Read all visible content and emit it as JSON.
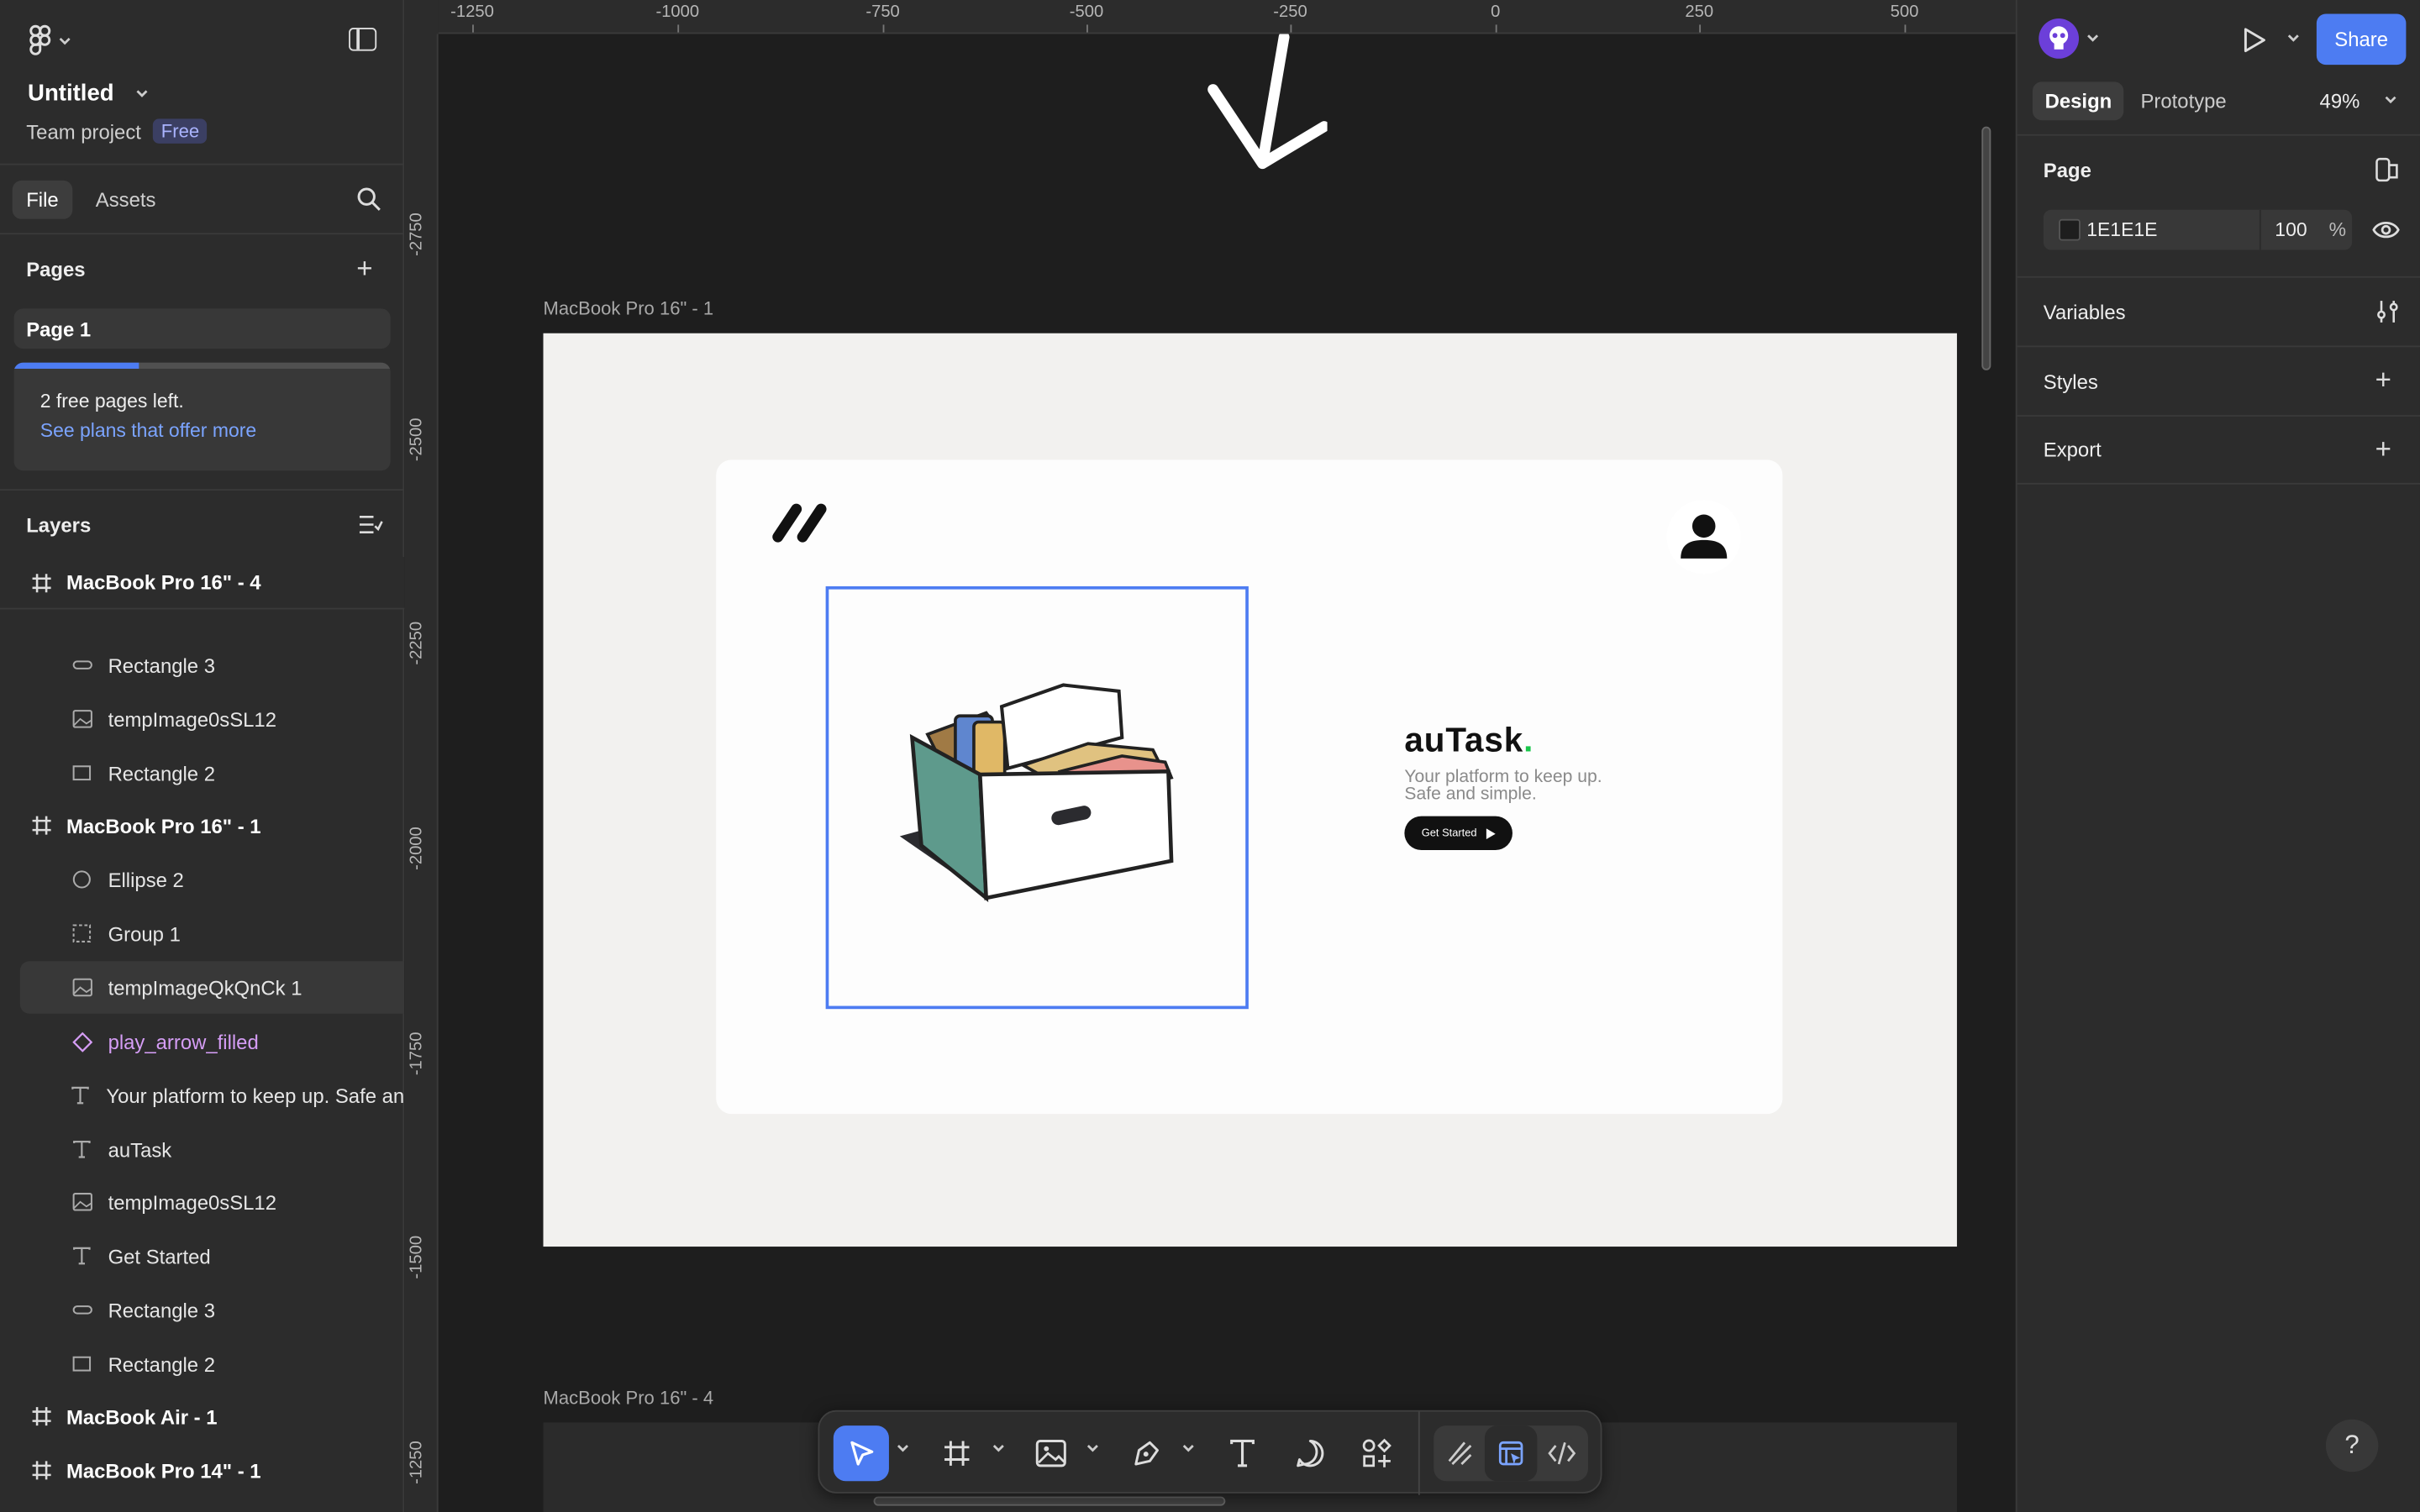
{
  "file": {
    "title": "Untitled",
    "team": "Team project",
    "plan_badge": "Free"
  },
  "left_tabs": [
    "File",
    "Assets"
  ],
  "pages": {
    "title": "Pages",
    "items": [
      "Page 1"
    ],
    "free_notice": "2 free pages left.",
    "free_link": "See plans that offer more",
    "usage_fraction": 0.33
  },
  "layers": {
    "title": "Layers",
    "items": [
      {
        "name": "MacBook Pro 16\" - 4",
        "type": "frame",
        "level": 0
      },
      {
        "name": "Get Started",
        "type": "text",
        "level": 1
      },
      {
        "name": "Rectangle 3",
        "type": "rect-rounded",
        "level": 1
      },
      {
        "name": "tempImage0sSL12",
        "type": "image",
        "level": 1
      },
      {
        "name": "Rectangle 2",
        "type": "rect",
        "level": 1
      },
      {
        "name": "MacBook Pro 16\" - 1",
        "type": "frame",
        "level": 0
      },
      {
        "name": "Ellipse 2",
        "type": "ellipse",
        "level": 1
      },
      {
        "name": "Group 1",
        "type": "group",
        "level": 1
      },
      {
        "name": "tempImageQkQnCk 1",
        "type": "image",
        "level": 1,
        "selected": true
      },
      {
        "name": "play_arrow_filled",
        "type": "component",
        "level": 1
      },
      {
        "name": "Your platform to keep up. Safe an",
        "type": "text",
        "level": 1
      },
      {
        "name": "auTask",
        "type": "text",
        "level": 1
      },
      {
        "name": "tempImage0sSL12",
        "type": "image",
        "level": 1
      },
      {
        "name": "Get Started",
        "type": "text",
        "level": 1
      },
      {
        "name": "Rectangle 3",
        "type": "rect-rounded",
        "level": 1
      },
      {
        "name": "Rectangle 2",
        "type": "rect",
        "level": 1
      },
      {
        "name": "MacBook Air - 1",
        "type": "frame",
        "level": 0
      },
      {
        "name": "MacBook Pro 14\" - 1",
        "type": "frame",
        "level": 0
      }
    ]
  },
  "rulers": {
    "top": [
      "-1250",
      "-1000",
      "-750",
      "-500",
      "-250",
      "0",
      "250",
      "500"
    ],
    "left": [
      "-2750",
      "-2500",
      "-2250",
      "-2000",
      "-1750",
      "-1500",
      "-1250"
    ]
  },
  "canvas": {
    "frame1_label": "MacBook Pro 16\" - 1",
    "frame4_label": "MacBook Pro 16\" - 4",
    "design": {
      "brand": "auTask",
      "brand_dot": ".",
      "tagline_line1": "Your platform to keep up.",
      "tagline_line2": "Safe and simple.",
      "cta": "Get Started"
    }
  },
  "toolbar": {
    "tools": [
      "move-tool",
      "frame-tool",
      "image-tool",
      "pen-tool",
      "text-tool",
      "comment-tool",
      "actions-tool"
    ],
    "modes": [
      "draw-mode",
      "design-mode",
      "dev-mode"
    ]
  },
  "right_panel": {
    "share_label": "Share",
    "tabs": [
      "Design",
      "Prototype"
    ],
    "zoom": "49%",
    "page_section": "Page",
    "bg_hex": "1E1E1E",
    "bg_opacity": "100",
    "opacity_unit": "%",
    "sections": [
      "Variables",
      "Styles",
      "Export"
    ],
    "help": "?"
  },
  "colors": {
    "accent": "#4d7cf2",
    "panel": "#2c2c2c",
    "canvas": "#1e1e1e",
    "component": "#d59df5",
    "brand_dot": "#19c64a"
  }
}
